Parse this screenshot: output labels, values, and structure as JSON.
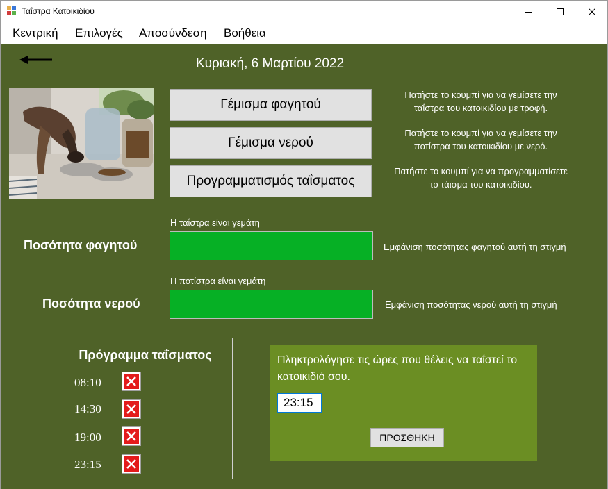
{
  "window": {
    "title": "Ταΐστρα Κατοικιδίου",
    "icon": "app-window-icon"
  },
  "menu": {
    "items": [
      {
        "label": "Κεντρική"
      },
      {
        "label": "Επιλογές"
      },
      {
        "label": "Αποσύνδεση"
      },
      {
        "label": "Βοήθεια"
      }
    ]
  },
  "header": {
    "back_icon": "arrow-left-icon",
    "date": "Κυριακή, 6 Μαρτίου 2022"
  },
  "actions": [
    {
      "label": "Γέμισμα φαγητού",
      "hint_line1": "Πατήστε το κουμπί για να γεμίσετε την",
      "hint_line2": "ταΐστρα του κατοικιδίου με τροφή."
    },
    {
      "label": "Γέμισμα νερού",
      "hint_line1": "Πατήστε το κουμπί για να γεμίσετε την",
      "hint_line2": "ποτίστρα του κατοικιδίου με νερό."
    },
    {
      "label": "Προγραμματισμός ταΐσματος",
      "hint_line1": "Πατήστε το κουμπί για να προγραμματίσετε",
      "hint_line2": "το τάισμα του κατοικιδίου."
    }
  ],
  "levels": {
    "food": {
      "label": "Ποσότητα φαγητού",
      "status": "Η ταΐστρα είναι γεμάτη",
      "description": "Εμφάνιση ποσότητας φαγητού αυτή τη στιγμή",
      "percent": 100
    },
    "water": {
      "label": "Ποσότητα νερού",
      "status": "Η ποτίστρα είναι γεμάτη",
      "description": "Εμφάνιση ποσότητας νερού αυτή τη στιγμή",
      "percent": 100
    }
  },
  "schedule": {
    "title": "Πρόγραμμα ταΐσματος",
    "times": [
      "08:10",
      "14:30",
      "19:00",
      "23:15"
    ],
    "delete_icon": "delete-x-icon"
  },
  "add_panel": {
    "prompt": "Πληκτρολόγησε τις ώρες που θέλεις να ταΐστεί το κατοικιδιό σου.",
    "input_value": "23:15",
    "button_label": "ΠΡΟΣΘΗΚΗ"
  },
  "colors": {
    "background": "#4f6228",
    "panel": "#6b8e23",
    "progress": "#06b025",
    "delete": "#e31b1b"
  }
}
